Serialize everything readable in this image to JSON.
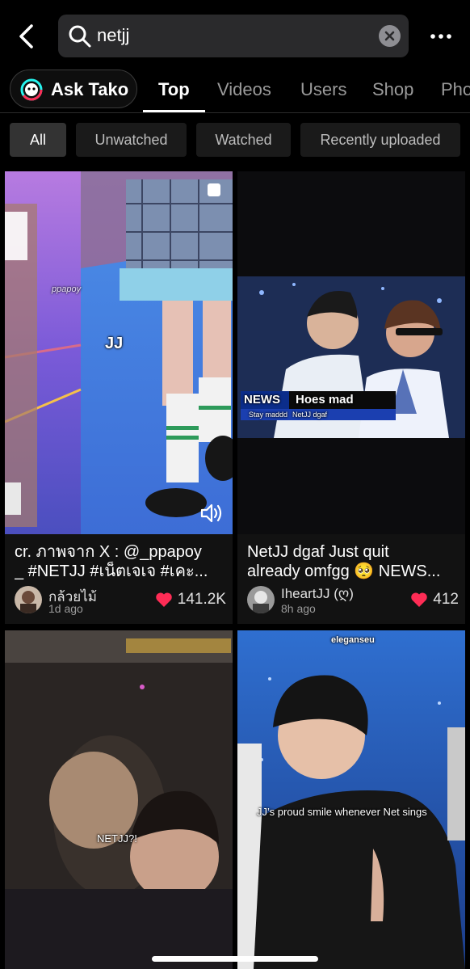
{
  "search": {
    "query": "netjj"
  },
  "tabs": {
    "ask_label": "Ask Tako",
    "items": [
      "Top",
      "Videos",
      "Users",
      "Shop",
      "Photos"
    ]
  },
  "filters": [
    "All",
    "Unwatched",
    "Watched",
    "Recently uploaded"
  ],
  "cards": [
    {
      "caption_line1": "cr. ภาพจาก X : @_ppapoy",
      "caption_line2": "_ #NETJJ #เน็ตเจเจ #เคะ...",
      "user": "กล้วยไม้",
      "age": "1d ago",
      "likes": "141.2K",
      "overlay_label": "JJ",
      "watermark": "ppapoy"
    },
    {
      "caption_line1": "NetJJ dgaf Just quit",
      "caption_line2": "already omfgg 🥺 NEWS...",
      "user": "IheartJJ (ღ)",
      "age": "8h ago",
      "likes": "412",
      "news_label": "NEWS",
      "news_headline": "Hoes mad",
      "news_sub1": "Stay maddd",
      "news_sub2": "NetJJ dgaf"
    },
    {
      "overlay_label": "NETJJ?!"
    },
    {
      "watermark": "eleganseu",
      "overlay_label": "JJ’s proud smile whenever Net sings"
    }
  ],
  "colors": {
    "heart": "#fe2c55",
    "background": "#000000",
    "chip_active": "#333333"
  }
}
